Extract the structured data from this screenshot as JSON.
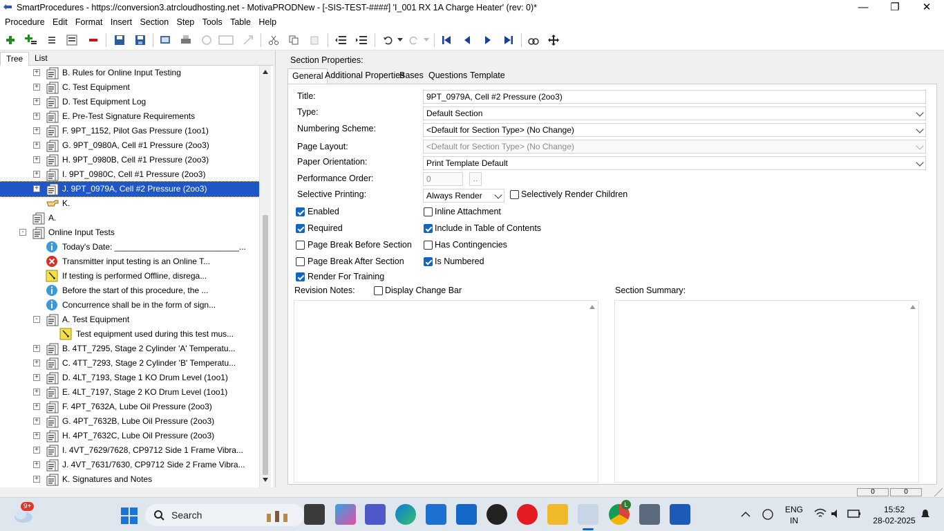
{
  "window": {
    "title": "SmartProcedures - https://conversion3.atrcloudhosting.net - MotivaPRODNew - [-SIS-TEST-####] 'I_001 RX 1A Charge Heater' (rev: 0)*",
    "minimize": "—",
    "restore": "❐",
    "close": "✕"
  },
  "menu": [
    "Procedure",
    "Edit",
    "Format",
    "Insert",
    "Section",
    "Step",
    "Tools",
    "Table",
    "Help"
  ],
  "left_tabs": [
    "Tree",
    "List"
  ],
  "tree": [
    {
      "label": "B. Rules for Online Input Testing",
      "indent": 2,
      "exp": "+",
      "icon": "section-icon"
    },
    {
      "label": "C. Test Equipment",
      "indent": 2,
      "exp": "+",
      "icon": "section-icon"
    },
    {
      "label": "D. Test Equipment Log",
      "indent": 2,
      "exp": "+",
      "icon": "section-icon"
    },
    {
      "label": "E. Pre-Test Signature Requirements",
      "indent": 2,
      "exp": "+",
      "icon": "section-icon"
    },
    {
      "label": "F. 9PT_1152, Pilot Gas Pressure (1oo1)",
      "indent": 2,
      "exp": "+",
      "icon": "section-icon"
    },
    {
      "label": "G. 9PT_0980A, Cell #1 Pressure (2oo3)",
      "indent": 2,
      "exp": "+",
      "icon": "section-icon"
    },
    {
      "label": "H. 9PT_0980B, Cell #1 Pressure (2oo3)",
      "indent": 2,
      "exp": "+",
      "icon": "section-icon"
    },
    {
      "label": "I. 9PT_0980C, Cell #1 Pressure (2oo3)",
      "indent": 2,
      "exp": "+",
      "icon": "section-icon"
    },
    {
      "label": "J. 9PT_0979A, Cell #2 Pressure (2oo3)",
      "indent": 2,
      "exp": "+",
      "icon": "section-icon",
      "selected": true
    },
    {
      "label": "K.",
      "indent": 2,
      "exp": "",
      "icon": "pointer-hand-icon"
    },
    {
      "label": "A.",
      "indent": 1,
      "exp": "",
      "icon": "section-icon"
    },
    {
      "label": "Online Input Tests",
      "indent": 1,
      "exp": "-",
      "icon": "section-icon"
    },
    {
      "label": "Today's Date: ___________________________...",
      "indent": 2,
      "exp": "",
      "icon": "info-icon"
    },
    {
      "label": "Transmitter input testing is an Online T...",
      "indent": 2,
      "exp": "",
      "icon": "warning-x-icon"
    },
    {
      "label": "If testing is performed Offline, disrega...",
      "indent": 2,
      "exp": "",
      "icon": "note-icon"
    },
    {
      "label": "Before the start of this procedure, the ...",
      "indent": 2,
      "exp": "",
      "icon": "info-icon"
    },
    {
      "label": "Concurrence shall be in the form of sign...",
      "indent": 2,
      "exp": "",
      "icon": "info-icon"
    },
    {
      "label": "A. Test Equipment",
      "indent": 2,
      "exp": "-",
      "icon": "section-icon"
    },
    {
      "label": "Test equipment used during this test mus...",
      "indent": 3,
      "exp": "",
      "icon": "note-icon"
    },
    {
      "label": "B. 4TT_7295, Stage 2 Cylinder 'A' Temperatu...",
      "indent": 2,
      "exp": "+",
      "icon": "section-icon"
    },
    {
      "label": "C. 4TT_7293, Stage 2 Cylinder 'B' Temperatu...",
      "indent": 2,
      "exp": "+",
      "icon": "section-icon"
    },
    {
      "label": "D. 4LT_7193, Stage 1 KO Drum Level (1oo1)",
      "indent": 2,
      "exp": "+",
      "icon": "section-icon"
    },
    {
      "label": "E. 4LT_7197, Stage 2 KO Drum Level (1oo1)",
      "indent": 2,
      "exp": "+",
      "icon": "section-icon"
    },
    {
      "label": "F. 4PT_7632A, Lube Oil Pressure (2oo3)",
      "indent": 2,
      "exp": "+",
      "icon": "section-icon"
    },
    {
      "label": "G. 4PT_7632B, Lube Oil Pressure (2oo3)",
      "indent": 2,
      "exp": "+",
      "icon": "section-icon"
    },
    {
      "label": "H. 4PT_7632C, Lube Oil Pressure (2oo3)",
      "indent": 2,
      "exp": "+",
      "icon": "section-icon"
    },
    {
      "label": "I. 4VT_7629/7628, CP9712 Side 1 Frame Vibra...",
      "indent": 2,
      "exp": "+",
      "icon": "section-icon"
    },
    {
      "label": "J. 4VT_7631/7630, CP9712 Side 2 Frame Vibra...",
      "indent": 2,
      "exp": "+",
      "icon": "section-icon"
    },
    {
      "label": "K. Signatures and Notes",
      "indent": 2,
      "exp": "+",
      "icon": "section-icon"
    }
  ],
  "section": {
    "header": "Section Properties:",
    "tabs": [
      "General",
      "Additional Properties",
      "Bases",
      "Questions",
      "Template"
    ],
    "labels": {
      "title": "Title:",
      "type": "Type:",
      "numbering": "Numbering Scheme:",
      "layout": "Page Layout:",
      "orientation": "Paper Orientation:",
      "perf": "Performance Order:",
      "selective": "Selective Printing:",
      "revision": "Revision Notes:",
      "summary": "Section Summary:"
    },
    "values": {
      "title": "9PT_0979A, Cell #2 Pressure (2oo3)",
      "type": "Default Section",
      "numbering": "<Default for Section Type> (No Change)",
      "layout": "<Default for Section Type> (No Change)",
      "orientation": "Print Template Default",
      "perf": "0",
      "perf_btn": "..",
      "selective": "Always Render"
    },
    "checkboxes": {
      "selectively_render_children": {
        "label": "Selectively Render Children",
        "checked": false
      },
      "enabled": {
        "label": "Enabled",
        "checked": true
      },
      "inline_attachment": {
        "label": "Inline Attachment",
        "checked": false
      },
      "required": {
        "label": "Required",
        "checked": true
      },
      "include_toc": {
        "label": "Include in Table of Contents",
        "checked": true
      },
      "page_break_before": {
        "label": "Page Break Before Section",
        "checked": false
      },
      "has_contingencies": {
        "label": "Has Contingencies",
        "checked": false
      },
      "page_break_after": {
        "label": "Page Break After Section",
        "checked": false
      },
      "is_numbered": {
        "label": "Is Numbered",
        "checked": true
      },
      "render_training": {
        "label": "Render For Training",
        "checked": true
      },
      "display_change_bar": {
        "label": "Display Change Bar",
        "checked": false
      }
    }
  },
  "status": {
    "cell1": "0",
    "cell2": "0"
  },
  "taskbar": {
    "search": "Search",
    "notif_badge": "9+",
    "chrome_badge": "L",
    "lang1": "ENG",
    "lang2": "IN",
    "time": "15:52",
    "date": "28-02-2025"
  }
}
